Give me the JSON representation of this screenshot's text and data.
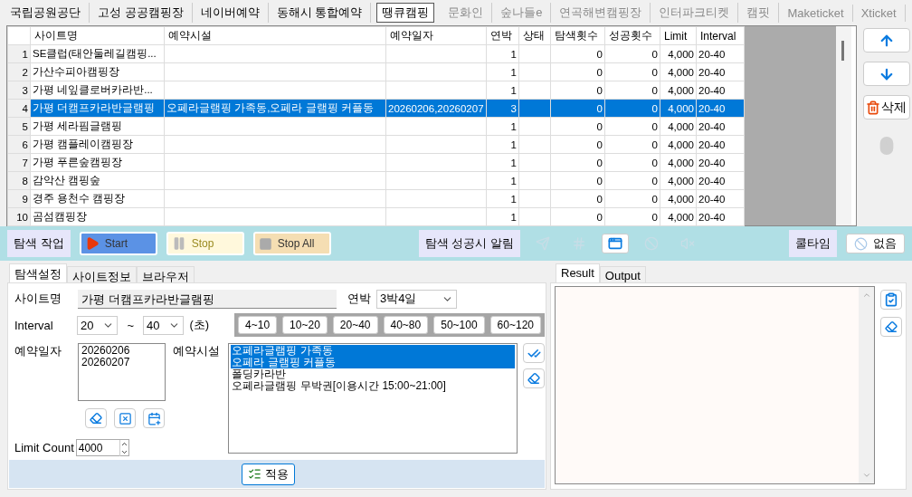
{
  "site_tabs": [
    {
      "label": "국립공원공단",
      "selected": false,
      "disabled": false
    },
    {
      "label": "고성 공공캠핑장",
      "selected": false,
      "disabled": false
    },
    {
      "label": "네이버예약",
      "selected": false,
      "disabled": false
    },
    {
      "label": "동해시 통합예약",
      "selected": false,
      "disabled": false
    },
    {
      "label": "땡큐캠핑",
      "selected": true,
      "disabled": false
    },
    {
      "label": "문화인",
      "selected": false,
      "disabled": true
    },
    {
      "label": "숲나들e",
      "selected": false,
      "disabled": true
    },
    {
      "label": "연곡해변캠핑장",
      "selected": false,
      "disabled": true
    },
    {
      "label": "인터파크티켓",
      "selected": false,
      "disabled": true
    },
    {
      "label": "캠핏",
      "selected": false,
      "disabled": true
    },
    {
      "label": "Maketicket",
      "selected": false,
      "disabled": true
    },
    {
      "label": "Xticket",
      "selected": false,
      "disabled": true
    }
  ],
  "table": {
    "columns": [
      "사이트명",
      "예약시설",
      "예약일자",
      "연박",
      "상태",
      "탐색횟수",
      "성공횟수",
      "Limit",
      "Interval"
    ],
    "rows": [
      {
        "number": "1",
        "site": "SE클럽(태안둘레길캠핑...",
        "nights": "1",
        "search_count": "0",
        "success_count": "0",
        "limit": "4,000",
        "interval": "20-40",
        "selected": false
      },
      {
        "number": "2",
        "site": "가산수피아캠핑장",
        "nights": "1",
        "search_count": "0",
        "success_count": "0",
        "limit": "4,000",
        "interval": "20-40",
        "selected": false
      },
      {
        "number": "3",
        "site": "가평 네잎클로버카라반...",
        "nights": "1",
        "search_count": "0",
        "success_count": "0",
        "limit": "4,000",
        "interval": "20-40",
        "selected": false
      },
      {
        "number": "4",
        "site": "가평 더캠프카라반글램핑",
        "facility": "오페라글램핑 가족동,오페라 글램핑 커플동",
        "dates": "20260206,20260207",
        "nights": "3",
        "search_count": "0",
        "success_count": "0",
        "limit": "4,000",
        "interval": "20-40",
        "selected": true
      },
      {
        "number": "5",
        "site": "가평 세라핌글램핑",
        "nights": "1",
        "search_count": "0",
        "success_count": "0",
        "limit": "4,000",
        "interval": "20-40",
        "selected": false
      },
      {
        "number": "6",
        "site": "가평 캠플레이캠핑장",
        "nights": "1",
        "search_count": "0",
        "success_count": "0",
        "limit": "4,000",
        "interval": "20-40",
        "selected": false
      },
      {
        "number": "7",
        "site": "가평 푸른숲캠핑장",
        "nights": "1",
        "search_count": "0",
        "success_count": "0",
        "limit": "4,000",
        "interval": "20-40",
        "selected": false
      },
      {
        "number": "8",
        "site": "감악산 캠핑숲",
        "nights": "1",
        "search_count": "0",
        "success_count": "0",
        "limit": "4,000",
        "interval": "20-40",
        "selected": false
      },
      {
        "number": "9",
        "site": "경주 용천수 캠핑장",
        "nights": "1",
        "search_count": "0",
        "success_count": "0",
        "limit": "4,000",
        "interval": "20-40",
        "selected": false
      },
      {
        "number": "10",
        "site": "곰섬캠핑장",
        "nights": "1",
        "search_count": "0",
        "success_count": "0",
        "limit": "4,000",
        "interval": "20-40",
        "selected": false
      }
    ]
  },
  "side_buttons": [
    {
      "kind": "up"
    },
    {
      "kind": "down"
    },
    {
      "kind": "delete",
      "label": "삭제"
    },
    {
      "kind": "mouse",
      "disabled": true
    }
  ],
  "toolbar": {
    "task_label": "탐색 작업",
    "buttons": [
      {
        "kind": "start",
        "label": "Start",
        "disabled": false
      },
      {
        "kind": "stop",
        "label": "Stop",
        "disabled": true
      },
      {
        "kind": "stop_all",
        "label": "Stop All",
        "disabled": false
      }
    ],
    "alert_label": "탐색 성공시 알림",
    "alerts": [
      {
        "kind": "send",
        "disabled": true
      },
      {
        "kind": "hash",
        "disabled": true
      },
      {
        "kind": "window",
        "disabled": false
      },
      {
        "kind": "ban",
        "disabled": true
      },
      {
        "kind": "mute",
        "disabled": true
      }
    ],
    "cooltime_label": "쿨타임",
    "cooltime_button": "없음"
  },
  "settings_tabs": [
    {
      "label": "탐색설정",
      "selected": true
    },
    {
      "label": "사이트정보",
      "selected": false
    },
    {
      "label": "브라우저",
      "selected": false
    }
  ],
  "form": {
    "site_name": {
      "label": "사이트명",
      "value": "가평 더캠프카라반글램핑"
    },
    "nights": {
      "label": "연박",
      "value": "3박4일"
    },
    "interval": {
      "label": "Interval",
      "min": "20",
      "separator": "~",
      "max": "40",
      "unit": "(초)"
    },
    "presets": [
      "4~10",
      "10~20",
      "20~40",
      "40~80",
      "50~100",
      "60~120"
    ],
    "dates": {
      "label": "예약일자",
      "items": [
        "20260206",
        "20260207"
      ]
    },
    "facilities": {
      "label": "예약시설",
      "items": [
        {
          "text": "오페라글램핑 가족동",
          "selected": true
        },
        {
          "text": "오페라 글램핑 커플동",
          "selected": true
        },
        {
          "text": "폴딩카라반",
          "selected": false
        },
        {
          "text": "오페라글램핑 무박권[이용시간 15:00~21:00]",
          "selected": false
        }
      ]
    },
    "limit": {
      "label": "Limit Count",
      "value": "4000"
    },
    "apply": "적용"
  },
  "output_tabs": [
    {
      "label": "Result",
      "selected": true
    },
    {
      "label": "Output",
      "selected": false
    }
  ]
}
